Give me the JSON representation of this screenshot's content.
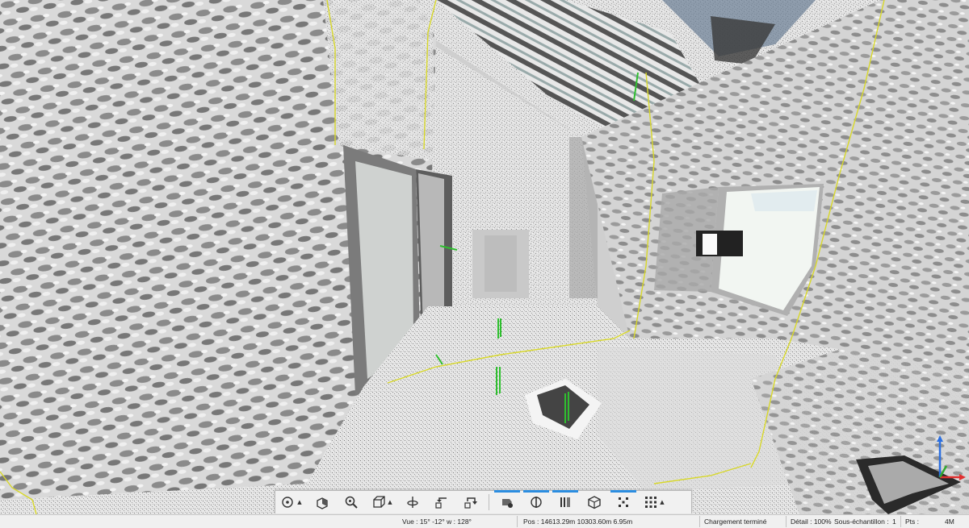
{
  "toolbar": {
    "buttons": [
      {
        "name": "orbit",
        "icon": "orbit-icon",
        "has_menu": true,
        "active": false
      },
      {
        "name": "walk",
        "icon": "walk-cube-icon",
        "has_menu": false,
        "active": false
      },
      {
        "name": "zoom",
        "icon": "zoom-icon",
        "has_menu": false,
        "active": false
      },
      {
        "name": "view-cube",
        "icon": "view-cube-icon",
        "has_menu": true,
        "active": false
      },
      {
        "name": "rotate-axis",
        "icon": "rotate-axis-icon",
        "has_menu": false,
        "active": false
      },
      {
        "name": "undo-view",
        "icon": "undo-view-icon",
        "has_menu": false,
        "active": false
      },
      {
        "name": "redo-view",
        "icon": "redo-view-icon",
        "has_menu": false,
        "active": false
      },
      {
        "name": "clip",
        "icon": "clip-icon",
        "has_menu": false,
        "active": true
      },
      {
        "name": "section",
        "icon": "section-icon",
        "has_menu": false,
        "active": true
      },
      {
        "name": "slice",
        "icon": "slice-icon",
        "has_menu": false,
        "active": true
      },
      {
        "name": "box",
        "icon": "box-icon",
        "has_menu": false,
        "active": false
      },
      {
        "name": "points",
        "icon": "points-icon",
        "has_menu": false,
        "active": true
      },
      {
        "name": "grid",
        "icon": "grid-icon",
        "has_menu": true,
        "active": false
      }
    ]
  },
  "statusbar": {
    "view": "Vue : 15° -12° w : 128°",
    "position": "Pos : 14613.29m 10303.60m 6.95m",
    "loading": "Chargement terminé",
    "detail": "Détail : 100%",
    "subsample": "Sous-échantillon :",
    "subsample_value": "1",
    "points": "Pts :",
    "points_value": "4M"
  },
  "gizmo": {
    "axes": [
      "x",
      "y",
      "z"
    ],
    "colors": {
      "x": "#e03030",
      "y": "#2ea82e",
      "z": "#2b6fe0"
    }
  },
  "colors": {
    "accent": "#2b8de0",
    "boundary_line": "#d8d82a",
    "marker": "#2fbf2f"
  }
}
